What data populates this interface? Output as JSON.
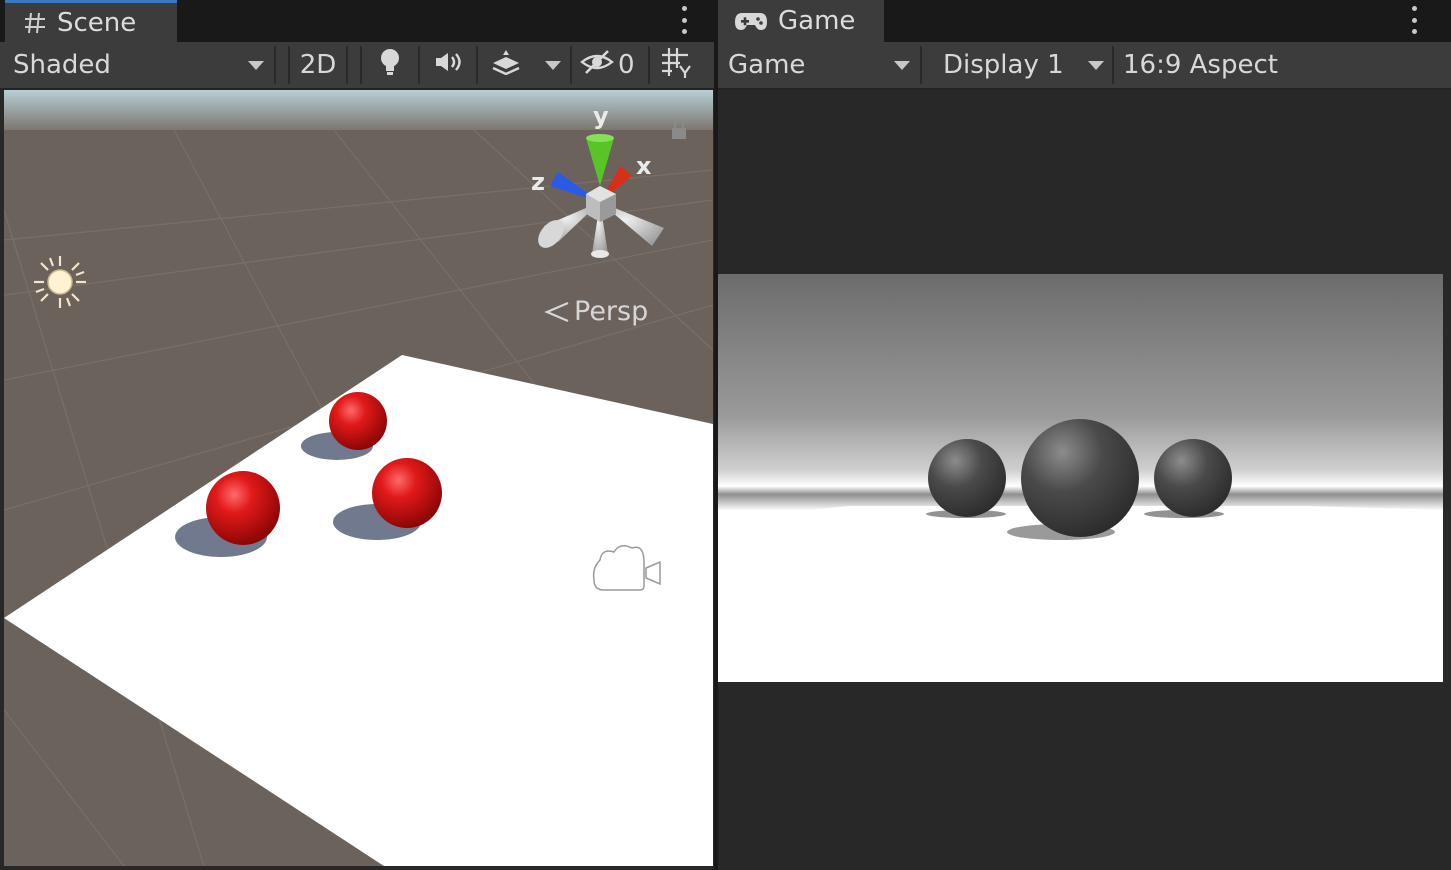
{
  "scene": {
    "tab_label": "Scene",
    "tab_icon": "grid-hash-icon",
    "shading_mode": "Shaded",
    "mode_2d": "2D",
    "icons": [
      "lightbulb-icon",
      "audio-speaker-icon",
      "effects-layers-icon",
      "visibility-hidden-icon",
      "grid-snap-icon"
    ],
    "hidden_count": "0",
    "gizmo": {
      "y_label": "y",
      "x_label": "x",
      "z_label": "z"
    },
    "projection_label": "Persp",
    "colors": {
      "sphere": "#e01818",
      "plane": "#ffffff",
      "ground": "#6b625c"
    }
  },
  "game": {
    "tab_label": "Game",
    "tab_icon": "gamepad-icon",
    "view_dropdown": "Game",
    "display_dropdown": "Display 1",
    "aspect_dropdown": "16:9 Aspect",
    "colors": {
      "sphere": "#444444"
    }
  }
}
